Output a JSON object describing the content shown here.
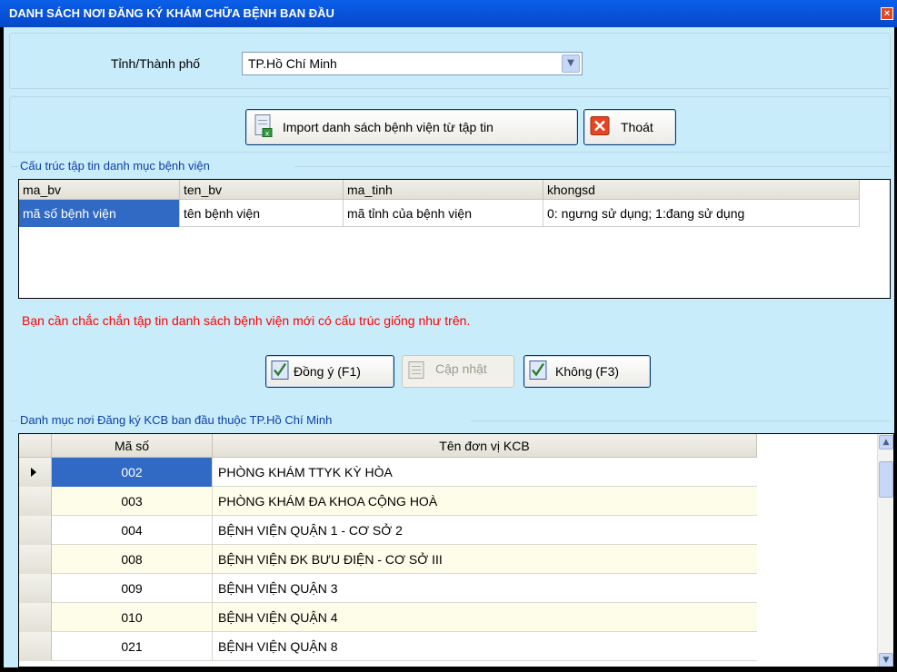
{
  "window": {
    "title": "DANH SÁCH NƠI ĐĂNG KÝ KHÁM CHỮA BỆNH BAN ĐẦU",
    "close_label": "×"
  },
  "province": {
    "label": "Tỉnh/Thành phố",
    "selected": "TP.Hồ Chí Minh"
  },
  "toolbar": {
    "import_label": "Import danh sách bệnh viện từ tập tin",
    "exit_label": "Thoát"
  },
  "structure": {
    "legend": "Cấu trúc tập tin danh mục bệnh viện",
    "columns": [
      "ma_bv",
      "ten_bv",
      "ma_tinh",
      "khongsd"
    ],
    "row": [
      "mã số bệnh viện",
      "tên bệnh viện",
      "mã tỉnh của bệnh viện",
      "0: ngưng sử dụng; 1:đang sử dụng"
    ]
  },
  "warning": "Bạn cần chắc chắn tập tin danh sách bệnh viện mới có cấu trúc giống như trên.",
  "actions": {
    "ok_label": "Đồng ý (F1)",
    "update_label": "Cập nhật",
    "no_label": "Không (F3)"
  },
  "list": {
    "legend": "Danh mục nơi Đăng ký KCB ban đầu thuộc TP.Hồ Chí Minh",
    "col_code": "Mã số",
    "col_name": "Tên đơn vị KCB",
    "rows": [
      {
        "code": "002",
        "name": "PHÒNG KHÁM TTYK KỲ HÒA"
      },
      {
        "code": "003",
        "name": "PHÒNG KHÁM ĐA  KHOA CỘNG HOÀ"
      },
      {
        "code": "004",
        "name": "BỆNH VIỆN QUẬN 1 - CƠ SỞ 2"
      },
      {
        "code": "008",
        "name": "BỆNH VIỆN ĐK BƯU ĐIỆN - CƠ SỞ III"
      },
      {
        "code": "009",
        "name": "BỆNH VIỆN QUẬN 3"
      },
      {
        "code": "010",
        "name": "BỆNH VIỆN QUẬN 4"
      },
      {
        "code": "021",
        "name": "BỆNH VIỆN QUẬN 8"
      }
    ]
  },
  "colors": {
    "titlebar": "#0647c9",
    "client_bg": "#c9ecfa",
    "selection": "#316ac5",
    "warning": "#ff0000",
    "legend": "#0b3fa8"
  },
  "icons": {
    "import": "table-import-icon",
    "exit": "red-x-icon",
    "ok": "check-document-icon",
    "update": "document-icon",
    "no": "check-document-icon"
  }
}
